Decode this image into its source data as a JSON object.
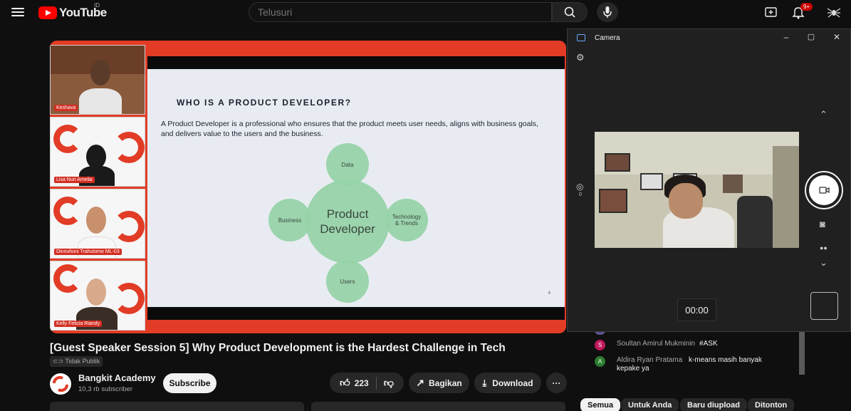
{
  "header": {
    "logo_text": "YouTube",
    "country_code": "ID",
    "search_placeholder": "Telusuri",
    "notification_count": "9+"
  },
  "video": {
    "slide": {
      "title": "WHO IS A PRODUCT DEVELOPER?",
      "body": "A Product Developer is a professional who ensures that the product meets user needs, aligns with business goals, and delivers value to the users and the business.",
      "center": "Product Developer",
      "nodes": {
        "top": "Data",
        "left": "Business",
        "right": "Technology & Trends",
        "bottom": "Users"
      },
      "page": "4"
    },
    "participants": [
      {
        "name": "Keshava"
      },
      {
        "name": "Lisa Nuri Amelia"
      },
      {
        "name": "Dinnuhoni Trahutomo ML-03"
      },
      {
        "name": "Kelly Felicia Riandy"
      }
    ]
  },
  "info": {
    "title": "[Guest Speaker Session 5] Why Product Development is the Hardest Challenge in Tech",
    "visibility": "Tidak Publik",
    "channel_name": "Bangkit Academy",
    "subscribers": "10,3 rb subscriber",
    "subscribe_label": "Subscribe",
    "likes": "223",
    "share_label": "Bagikan",
    "download_label": "Download",
    "more_label": "···"
  },
  "chat": {
    "messages": [
      {
        "initial": "S",
        "author": "Soultan Amirul Mukminin",
        "text": "#ASK",
        "color": "#c2185b"
      },
      {
        "initial": "A",
        "author": "Aldira Ryan Pratama",
        "text": "k-means masih banyak kepake ya",
        "color": "#2e7d32"
      }
    ]
  },
  "chips": [
    "Semua",
    "Untuk Anda",
    "Baru diupload",
    "Ditonton"
  ],
  "camera": {
    "title": "Camera",
    "minimize": "–",
    "maximize": "▢",
    "close": "✕",
    "timer": "00:00",
    "exposure_value": "0"
  },
  "colors": {
    "youtube_red": "#ff0000",
    "bangkit_red": "#e23c26",
    "circle_green": "#96d3a8"
  }
}
